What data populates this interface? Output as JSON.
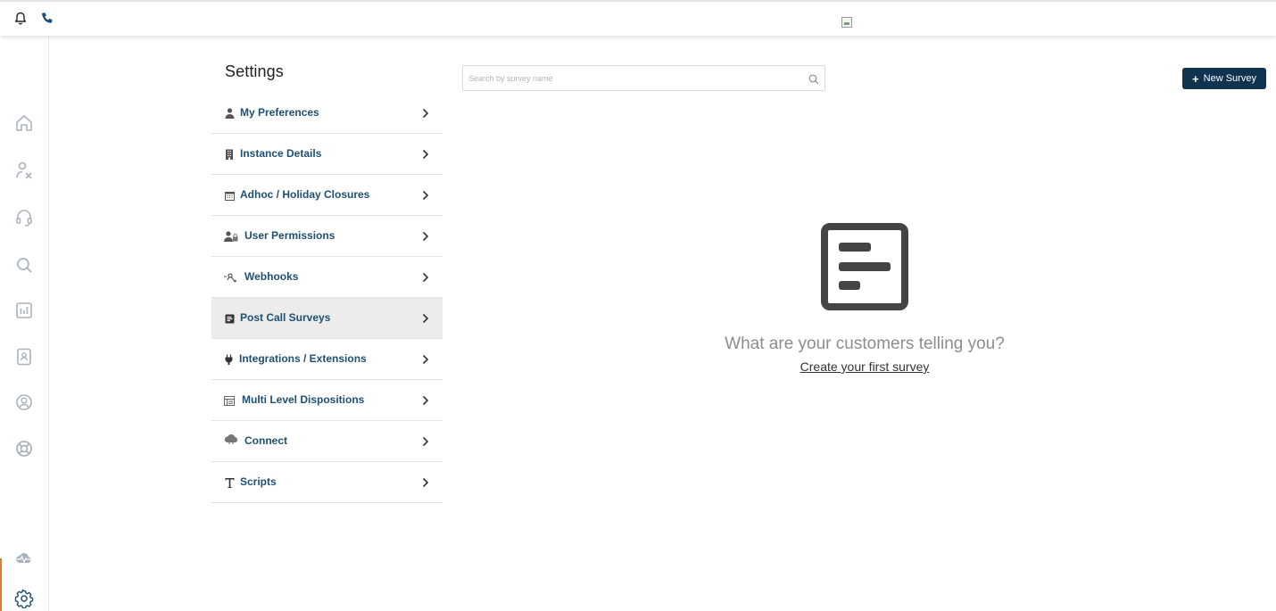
{
  "topbar": {
    "icons": [
      "bell-icon",
      "phone-icon"
    ]
  },
  "leftnav": {
    "icons": [
      "home-icon",
      "user-switch-icon",
      "headset-icon",
      "search-icon",
      "reports-icon",
      "contacts-icon",
      "account-icon",
      "support-icon",
      "status-cloud-icon",
      "gear-icon"
    ]
  },
  "settings": {
    "title": "Settings",
    "items": [
      {
        "label": "My Preferences",
        "icon": "person-icon"
      },
      {
        "label": "Instance Details",
        "icon": "building-icon"
      },
      {
        "label": "Adhoc / Holiday Closures",
        "icon": "calendar-icon"
      },
      {
        "label": "User Permissions",
        "icon": "user-lock-icon"
      },
      {
        "label": "Webhooks",
        "icon": "webhook-icon"
      },
      {
        "label": "Post Call Surveys",
        "icon": "survey-icon",
        "active": true
      },
      {
        "label": "Integrations / Extensions",
        "icon": "plug-icon"
      },
      {
        "label": "Multi Level Dispositions",
        "icon": "list-icon"
      },
      {
        "label": "Connect",
        "icon": "cloud-icon"
      },
      {
        "label": "Scripts",
        "icon": "text-icon"
      }
    ]
  },
  "search": {
    "placeholder": "Search by survey name",
    "value": ""
  },
  "toolbar": {
    "new_survey_label": "New Survey"
  },
  "empty_state": {
    "title": "What are your customers telling you?",
    "link": "Create your first survey"
  },
  "colors": {
    "primary": "#10344f",
    "menu_text": "#1f4f73",
    "active_accent": "#e07a2f"
  }
}
